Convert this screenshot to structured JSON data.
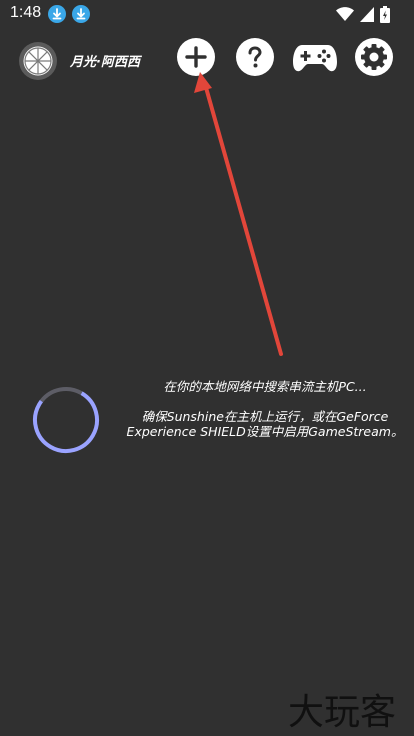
{
  "status_bar": {
    "time": "1:48",
    "icons": [
      "download-icon",
      "download-icon",
      "wifi-icon",
      "signal-icon",
      "battery-icon"
    ]
  },
  "toolbar": {
    "pc_name": "月光·阿西西",
    "logo_icon": "moonlight-logo-icon",
    "buttons": [
      {
        "name": "add",
        "icon": "plus-icon"
      },
      {
        "name": "help",
        "icon": "question-icon"
      },
      {
        "name": "gamepad",
        "icon": "gamepad-icon"
      },
      {
        "name": "settings",
        "icon": "gear-icon"
      }
    ]
  },
  "main": {
    "search_title": "在你的本地网络中搜索串流主机PC...",
    "search_hint": "确保Sunshine在主机上运行，或在GeForce Experience SHIELD设置中启用GameStream。"
  },
  "watermark": "大玩客",
  "colors": {
    "background": "#303030",
    "arrow": "#e2463a",
    "spinner_start": "#9aa3ff",
    "spinner_end": "#5a5a5a",
    "button_bg": "#ffffff",
    "button_fg": "#303030"
  }
}
